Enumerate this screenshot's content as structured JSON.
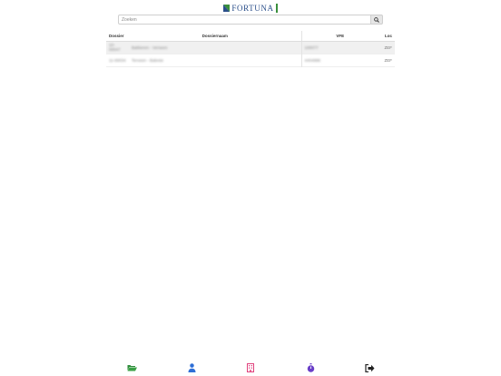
{
  "brand": {
    "name": "FORTUNA"
  },
  "search": {
    "placeholder": "Zoeken"
  },
  "table": {
    "headers": {
      "dossier": "Dossier",
      "dossiernaam": "Dossiernaam",
      "vfe": "VFE",
      "loc": "Loc"
    },
    "rows": [
      {
        "dossier": "10-00047",
        "dossiernaam": "Bakkeren - Verseen",
        "vfe": "100077",
        "loc": "ZEF"
      },
      {
        "dossier": "11-00034",
        "dossiernaam": "Terveen - Baleste",
        "vfe": "4404986",
        "loc": "ZEF"
      }
    ]
  },
  "nav": {
    "items": [
      {
        "name": "folder-icon",
        "color": "#2e8b3a"
      },
      {
        "name": "person-icon",
        "color": "#2f6fd6"
      },
      {
        "name": "building-icon",
        "color": "#e0407c"
      },
      {
        "name": "stopwatch-icon",
        "color": "#6a3fc8"
      },
      {
        "name": "logout-icon",
        "color": "#222222"
      }
    ]
  }
}
